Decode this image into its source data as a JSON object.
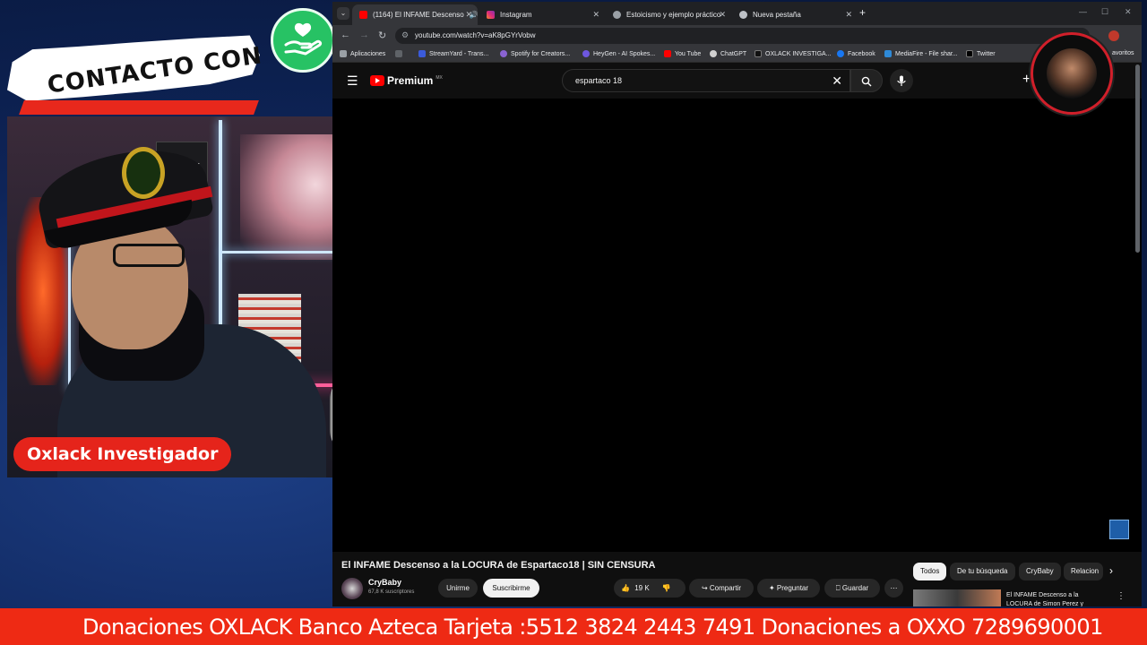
{
  "overlay": {
    "banner_text": "CONTACTO CON",
    "host_name": "Oxlack Investigador",
    "poster_text": "OXLACK",
    "ticker": "Donaciones OXLACK Banco Azteca Tarjeta :5512 3824 2443 7491 Donaciones a OXXO 7289690001",
    "accent_red": "#e5241b",
    "accent_green": "#27c264"
  },
  "browser": {
    "tabs": [
      {
        "label": "(1164) El INFAME Descenso",
        "icon": "youtube-icon",
        "active": true
      },
      {
        "label": "Instagram",
        "icon": "instagram-icon",
        "active": false
      },
      {
        "label": "Estoicismo y ejemplo práctico",
        "icon": "globe-icon",
        "active": false
      },
      {
        "label": "Nueva pestaña",
        "icon": "chrome-icon",
        "active": false
      }
    ],
    "url": "youtube.com/watch?v=aK8pGYrVobw",
    "bookmarks": [
      "Aplicaciones",
      "StreamYard - Trans...",
      "Spotify for Creators...",
      "HeyGen - AI Spokes...",
      "You Tube",
      "ChatGPT",
      "OXLACK INVESTIGA...",
      "Facebook",
      "MediaFire - File shar...",
      "Twitter",
      "avoritos"
    ]
  },
  "youtube": {
    "logo_text": "Premium",
    "logo_region": "MX",
    "search_query": "espartaco 18",
    "video_title": "El INFAME Descenso a la LOCURA de Espartaco18 | SIN CENSURA",
    "channel": "CryBaby",
    "subscribers": "67,8 K suscriptores",
    "join_label": "Unirme",
    "subscribe_label": "Suscribirme",
    "likes": "19 K",
    "share_label": "Compartir",
    "ask_label": "Preguntar",
    "save_label": "Guardar",
    "chips": [
      "Todos",
      "De tu búsqueda",
      "CryBaby",
      "Relacion"
    ],
    "recommended_title": "El INFAME Descenso a la LOCURA de Simon Perez y"
  }
}
